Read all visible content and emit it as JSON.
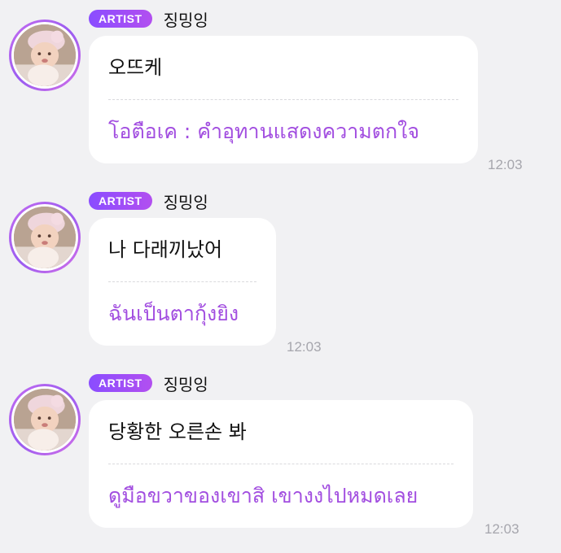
{
  "colors": {
    "background": "#f1f1f3",
    "bubble": "#ffffff",
    "translation_text": "#a24ee0",
    "badge_gradient_start": "#8a4dff",
    "badge_gradient_end": "#b24ff0",
    "timestamp": "#a6a6ad"
  },
  "messages": [
    {
      "badge": "ARTIST",
      "author": "징밍잉",
      "original": "오뜨케",
      "translation": "โอตือเค : คำอุทานแสดงความตกใจ",
      "time": "12:03"
    },
    {
      "badge": "ARTIST",
      "author": "징밍잉",
      "original": "나 다래끼났어",
      "translation": "ฉันเป็นตากุ้งยิง",
      "time": "12:03"
    },
    {
      "badge": "ARTIST",
      "author": "징밍잉",
      "original": "당황한 오른손 봐",
      "translation": "ดูมือขวาของเขาสิ เขางงไปหมดเลย",
      "time": "12:03"
    }
  ]
}
